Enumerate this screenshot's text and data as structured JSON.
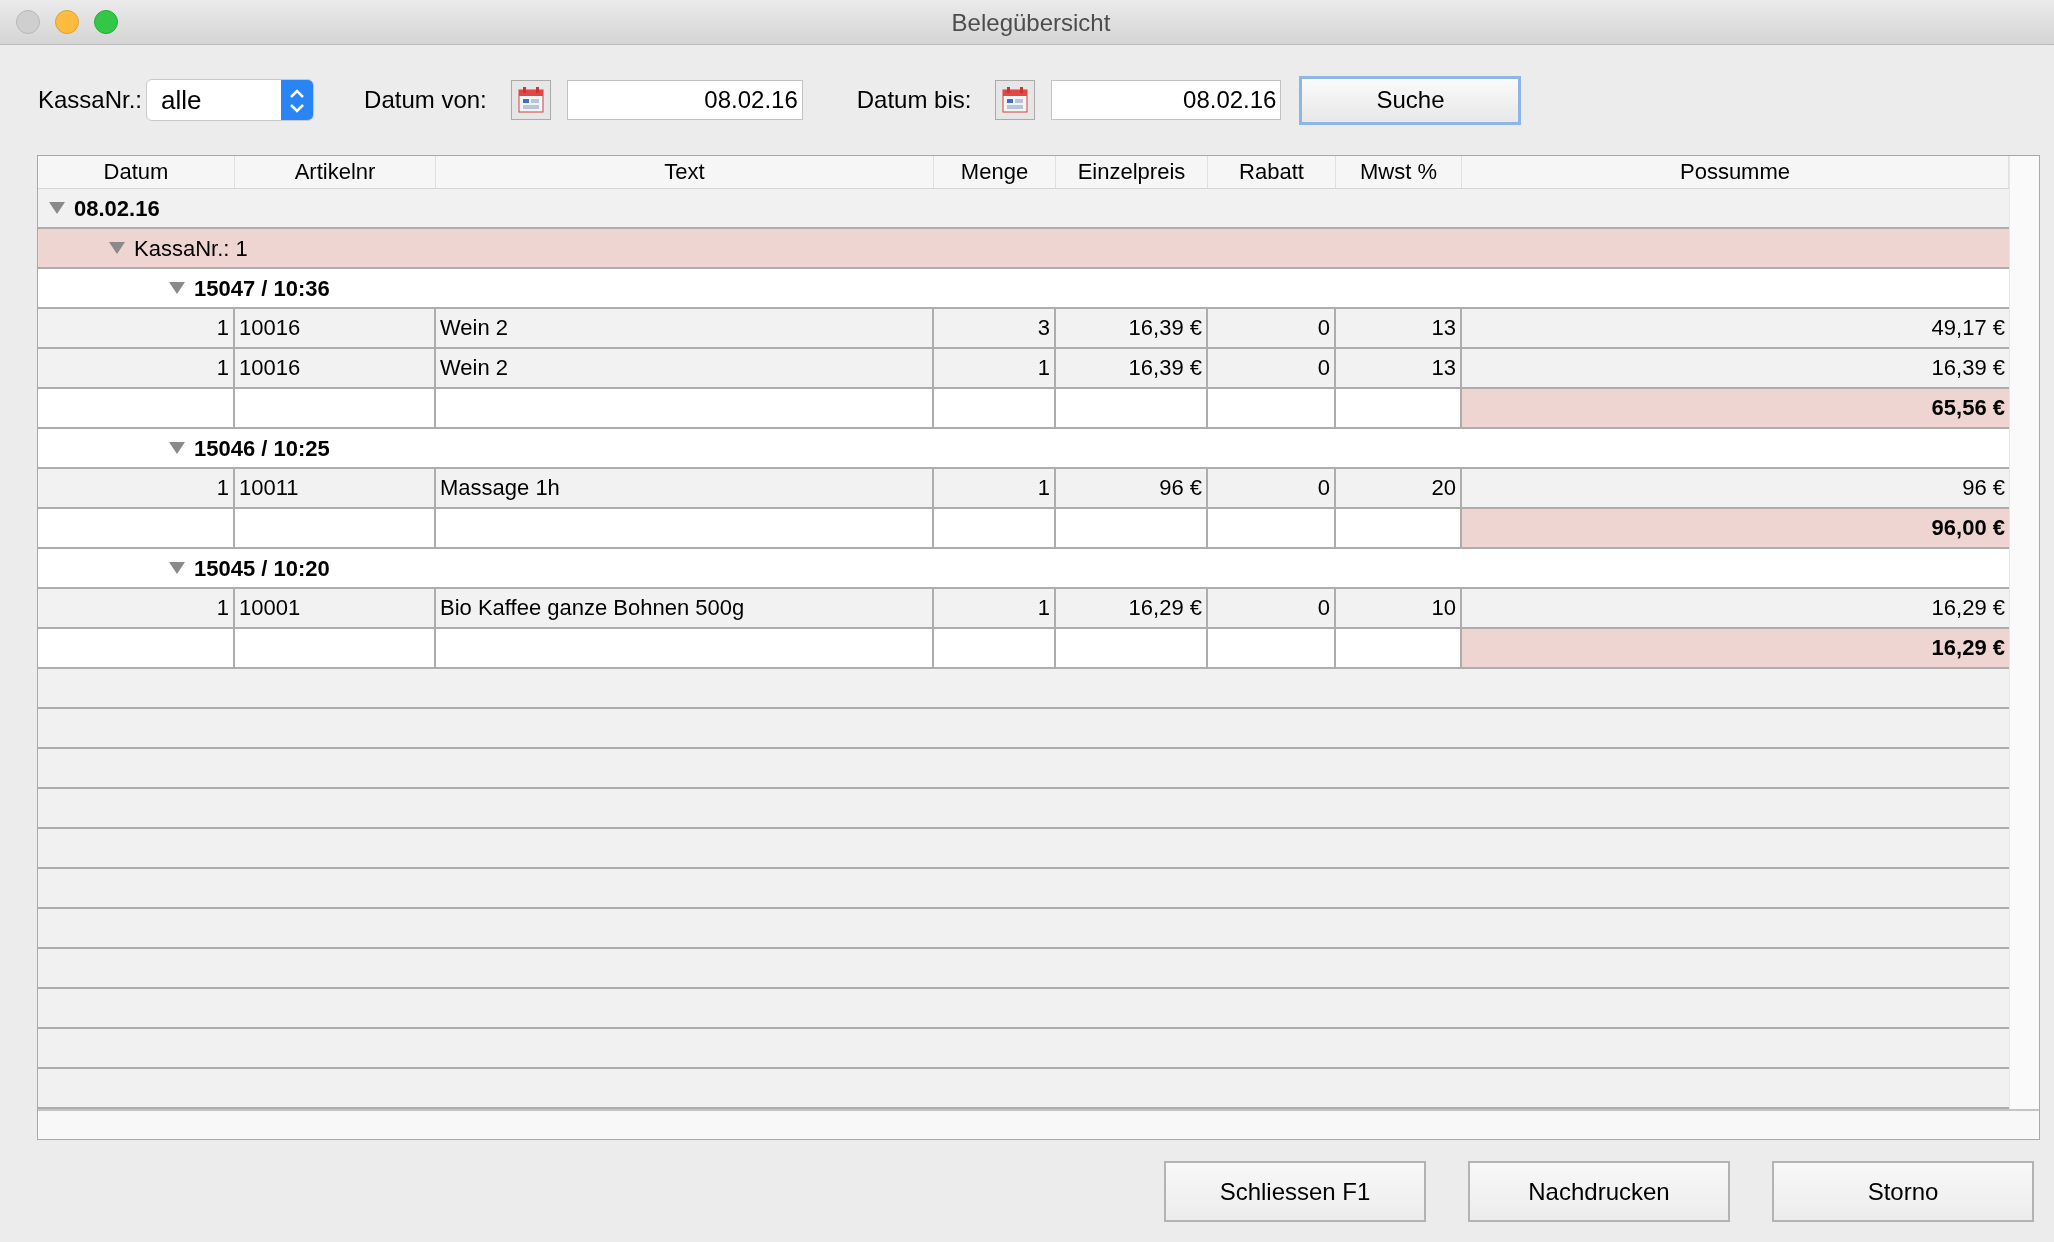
{
  "window": {
    "title": "Belegübersicht"
  },
  "toolbar": {
    "kassa_label": "KassaNr.:",
    "kassa_value": "alle",
    "von_label": "Datum von:",
    "von_value": "08.02.16",
    "bis_label": "Datum bis:",
    "bis_value": "08.02.16",
    "search_button": "Suche"
  },
  "table": {
    "columns": [
      "Datum",
      "Artikelnr",
      "Text",
      "Menge",
      "Einzelpreis",
      "Rabatt",
      "Mwst %",
      "Possumme"
    ],
    "tree": [
      {
        "label": "08.02.16",
        "expanded": true,
        "children": [
          {
            "label": "KassaNr.: 1",
            "expanded": true,
            "children": [
              {
                "label": "15047 / 10:36",
                "expanded": true,
                "items": [
                  {
                    "cells": [
                      "1",
                      "10016",
                      "Wein 2",
                      "3",
                      "16,39 €",
                      "0",
                      "13",
                      "49,17 €"
                    ]
                  },
                  {
                    "cells": [
                      "1",
                      "10016",
                      "Wein 2",
                      "1",
                      "16,39 €",
                      "0",
                      "13",
                      "16,39 €"
                    ]
                  }
                ],
                "total": "65,56 €"
              },
              {
                "label": "15046 / 10:25",
                "expanded": true,
                "items": [
                  {
                    "cells": [
                      "1",
                      "10011",
                      "Massage 1h",
                      "1",
                      "96 €",
                      "0",
                      "20",
                      "96 €"
                    ]
                  }
                ],
                "total": "96,00 €"
              },
              {
                "label": "15045 / 10:20",
                "expanded": true,
                "items": [
                  {
                    "cells": [
                      "1",
                      "10001",
                      "Bio Kaffee ganze Bohnen 500g",
                      "1",
                      "16,29 €",
                      "0",
                      "10",
                      "16,29 €"
                    ]
                  }
                ],
                "total": "16,29 €"
              }
            ]
          }
        ]
      }
    ]
  },
  "buttons": [
    "Schliessen F1",
    "Nachdrucken",
    "Storno"
  ]
}
